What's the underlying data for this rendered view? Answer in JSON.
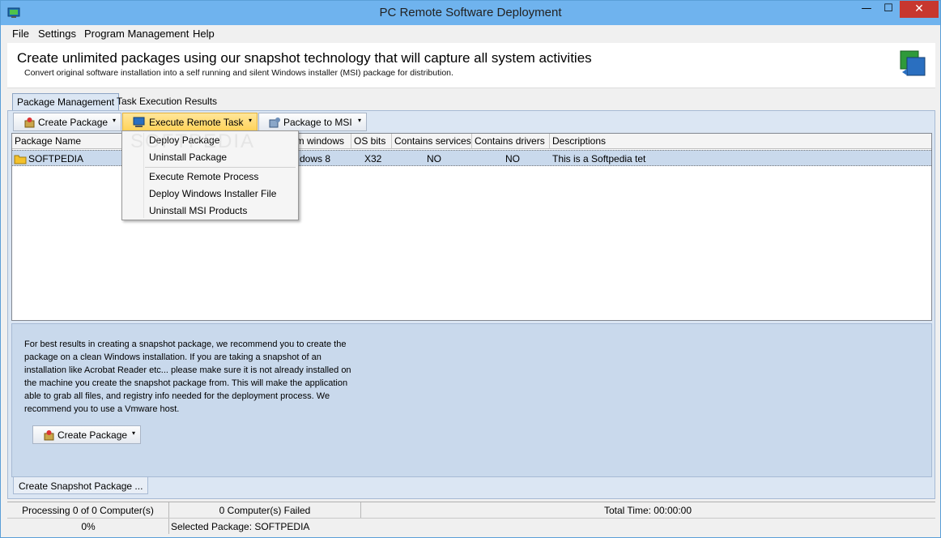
{
  "window": {
    "title": "PC Remote Software Deployment",
    "minimize_glyph": "—",
    "maximize_glyph": "☐",
    "close_glyph": "✕"
  },
  "menu": [
    "File",
    "Settings",
    "Program Management",
    "Help"
  ],
  "header": {
    "headline": "Create unlimited packages using our snapshot technology that will capture all system activities",
    "subline": "Convert original software installation into a self running and silent Windows installer (MSI) package for distribution."
  },
  "tabs": [
    "Package Management",
    "Task Execution Results"
  ],
  "toolbar": {
    "create_package": "Create Package",
    "execute_remote_task": "Execute Remote Task",
    "package_to_msi": "Package to MSI",
    "arrow": "▾"
  },
  "grid": {
    "columns": [
      "Package Name",
      "om windows",
      "OS bits",
      "Contains services",
      "Contains drivers",
      "Descriptions"
    ],
    "rows": [
      {
        "name": "SOFTPEDIA",
        "windows": "dows 8",
        "bits": "X32",
        "services": "NO",
        "drivers": "NO",
        "description": "This is a Softpedia tet"
      }
    ]
  },
  "dropdown": {
    "items": [
      "Deploy Package",
      "Uninstall Package",
      "Execute Remote Process",
      "Deploy Windows Installer File",
      "Uninstall MSI Products"
    ]
  },
  "advice": "For best results in creating a snapshot package, we recommend you to create the package on a clean Windows installation. If you are taking a snapshot of an installation like Acrobat Reader etc... please make sure it is not already installed on the machine you create the snapshot package from. This will make the application able to grab all files, and registry info needed for the deployment process. We recommend you to use a Vmware host.",
  "lower_button": "Create Package",
  "bottom_tab": "Create Snapshot Package ...",
  "status": {
    "processing": "Processing 0 of 0 Computer(s)",
    "failed": "0 Computer(s) Failed",
    "total_time": "Total Time: 00:00:00",
    "progress_text": "0%",
    "progress_value": 0,
    "selected": "Selected Package: SOFTPEDIA"
  },
  "watermark": "SOFTPEDIA",
  "colors": {
    "titlebar": "#6fb3ee",
    "close": "#c7372f",
    "highlight": "#ffd35a",
    "selection": "#c9d9ec",
    "panel": "#dbe6f3"
  }
}
